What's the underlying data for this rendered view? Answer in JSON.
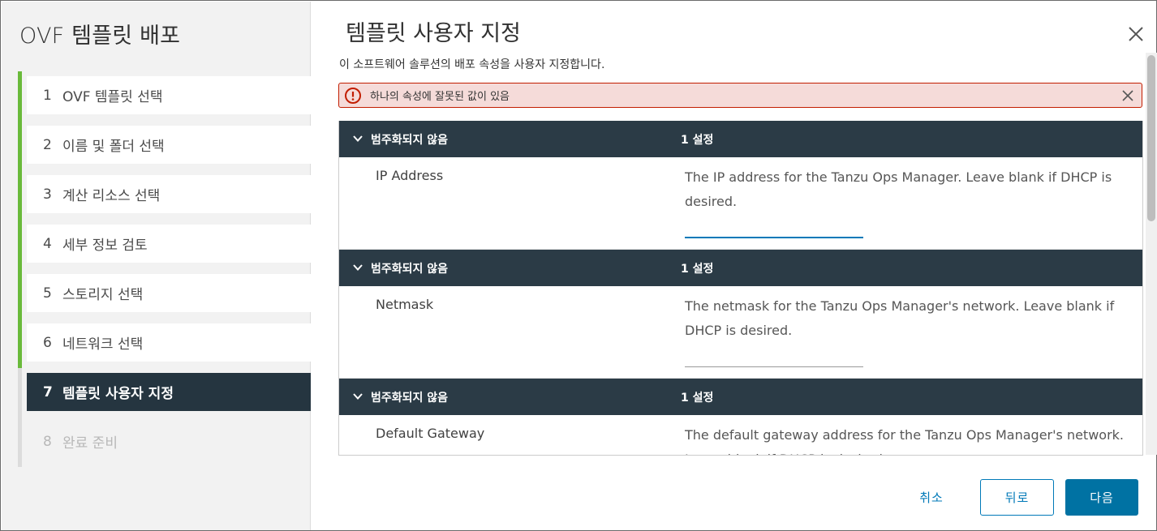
{
  "wizard": {
    "title": "OVF 템플릿 배포",
    "steps": [
      {
        "num": "1",
        "label": "OVF 템플릿 선택"
      },
      {
        "num": "2",
        "label": "이름 및 폴더 선택"
      },
      {
        "num": "3",
        "label": "계산 리소스 선택"
      },
      {
        "num": "4",
        "label": "세부 정보 검토"
      },
      {
        "num": "5",
        "label": "스토리지 선택"
      },
      {
        "num": "6",
        "label": "네트워크 선택"
      },
      {
        "num": "7",
        "label": "템플릿 사용자 지정"
      },
      {
        "num": "8",
        "label": "완료 준비"
      }
    ]
  },
  "main": {
    "title": "템플릿 사용자 지정",
    "subtitle": "이 소프트웨어 솔루션의 배포 속성을 사용자 지정합니다.",
    "alert": {
      "text": "하나의 속성에 잘못된 값이 있음"
    },
    "groups": [
      {
        "name": "범주화되지 않음",
        "count": "1 설정",
        "label": "IP Address",
        "description": "The IP address for the Tanzu Ops Manager. Leave blank if DHCP is desired.",
        "value": ""
      },
      {
        "name": "범주화되지 않음",
        "count": "1 설정",
        "label": "Netmask",
        "description": "The netmask for the Tanzu Ops Manager's network. Leave blank if DHCP is desired.",
        "value": ""
      },
      {
        "name": "범주화되지 않음",
        "count": "1 설정",
        "label": "Default Gateway",
        "description": "The default gateway address for the Tanzu Ops Manager's network. Leave blank if DHCP is desired.",
        "value": ""
      }
    ]
  },
  "footer": {
    "cancel_label": "취소",
    "back_label": "뒤로",
    "next_label": "다음"
  },
  "colors": {
    "accent": "#0079b8",
    "header_dark": "#2b3b46",
    "step_complete": "#6aba3b",
    "error": "#c21d00"
  },
  "icons": {
    "close": "close-icon",
    "alert": "exclamation-circle-icon",
    "chevron": "chevron-down-icon"
  }
}
